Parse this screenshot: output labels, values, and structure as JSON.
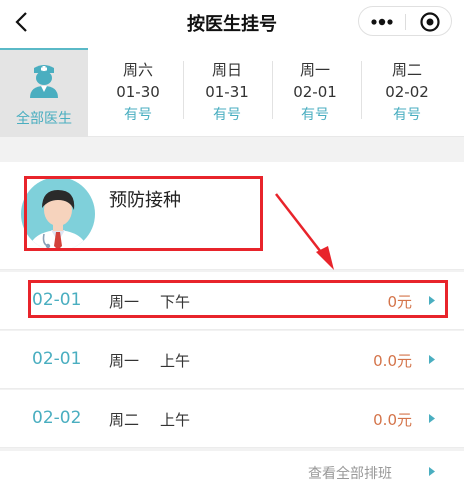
{
  "header": {
    "title": "按医生挂号",
    "back_icon": "chevron-left-icon",
    "more_icon": "more-dots-icon",
    "target_icon": "target-icon"
  },
  "date_strip": {
    "all_label": "全部医生",
    "days": [
      {
        "weekday": "周六",
        "date": "01-30",
        "availability": "有号"
      },
      {
        "weekday": "周日",
        "date": "01-31",
        "availability": "有号"
      },
      {
        "weekday": "周一",
        "date": "02-01",
        "availability": "有号"
      },
      {
        "weekday": "周二",
        "date": "02-02",
        "availability": "有号"
      }
    ]
  },
  "doctor": {
    "name": "预防接种"
  },
  "schedule": [
    {
      "date": "02-01",
      "weekday": "周一",
      "half": "下午",
      "price": "0元"
    },
    {
      "date": "02-01",
      "weekday": "周一",
      "half": "上午",
      "price": "0.0元"
    },
    {
      "date": "02-02",
      "weekday": "周二",
      "half": "上午",
      "price": "0.0元"
    }
  ],
  "footer": {
    "view_all": "查看全部排班"
  },
  "colors": {
    "accent": "#4aaec0",
    "price": "#d4744a",
    "highlight": "#e8242b"
  }
}
